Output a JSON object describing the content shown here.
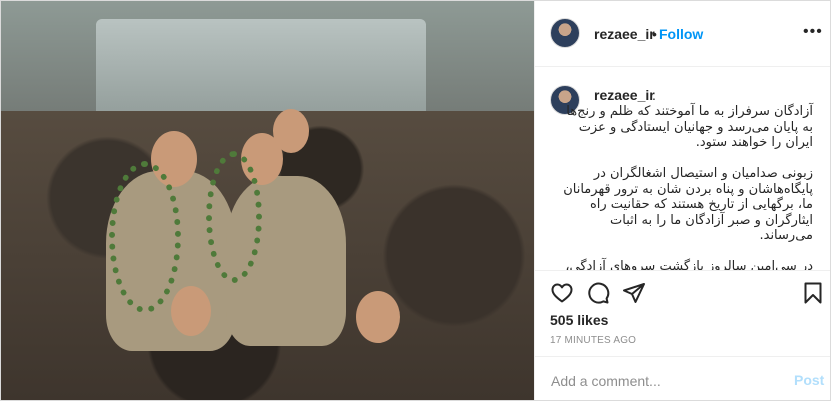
{
  "header": {
    "username": "rezaee_ir",
    "separator": "•",
    "follow_label": "Follow",
    "more_label": "•••"
  },
  "photo": {
    "alt_icon": "post-photo"
  },
  "caption": {
    "username": "rezaee_ir",
    "dot": ".",
    "text": "آزادگان سرفراز به ما آموختند که ظلم و رنج‌ها به پایان می‌رسد و جهانیان ایستادگی و عزت ایران را خواهند ستود.\n\nزبونی صدامیان و استیصال اشغالگران در پایگاه‌هاشان و پناه بردن شان به ترور قهرمانان ما، برگهایی از تاریخ هستند که حقانیت راه ایثارگران و صبر آزادگان ما را به اثبات می‌رساند.\n\nدر سی‌امین سالروز بازگشت سروهای آزادگی،"
  },
  "actions": {
    "like_icon": "heart-icon",
    "comment_icon": "comment-icon",
    "share_icon": "share-icon",
    "save_icon": "bookmark-icon",
    "likes": "505 likes",
    "time": "17 MINUTES AGO"
  },
  "comment": {
    "placeholder": "Add a comment...",
    "post_label": "Post"
  },
  "colors": {
    "accent": "#0095f6",
    "post_disabled": "#b2dffc",
    "muted": "#8e8e8e",
    "border": "#dbdbdb"
  }
}
